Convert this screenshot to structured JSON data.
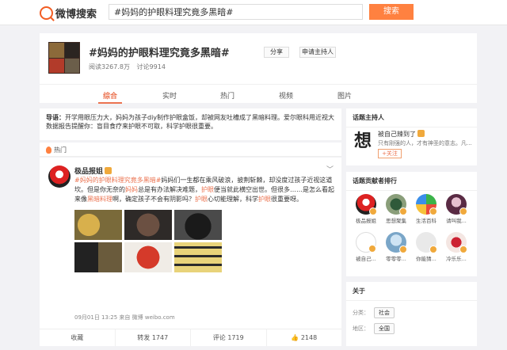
{
  "header": {
    "logo_text": "微博搜索",
    "search_value": "#妈妈的护眼料理究竟多黑暗#",
    "search_button": "搜索"
  },
  "topic": {
    "title": "#妈妈的护眼料理究竟多黑暗#",
    "share_label": "分享",
    "host_apply_label": "申请主持人",
    "reads": "阅读3267.8万",
    "discussions": "讨论9914",
    "tabs": [
      {
        "label": "综合",
        "active": true
      },
      {
        "label": "实时",
        "active": false
      },
      {
        "label": "热门",
        "active": false
      },
      {
        "label": "视频",
        "active": false
      },
      {
        "label": "图片",
        "active": false
      }
    ]
  },
  "lead": {
    "label": "导语：",
    "text": "开学用眼压力大，妈妈为孩子diy制作护眼盒饭，却被网友吐槽成了黑暗料理。爱尔眼科用近视大数据报告提醒你：盲目食疗来护眼不可取，科学护眼很重要。"
  },
  "hot_section": {
    "label": "热门"
  },
  "post": {
    "author": "极品报姐",
    "more": "﹀",
    "text_link1": "#妈妈的护眼料理究竟多黑暗#",
    "text_part1": "妈妈们一生都在乘风破浪，披荆斩棘，却没度过孩子近视这道坎。但是你无奈的",
    "text_link2": "妈妈",
    "text_part2": "总是有办法解决难题，",
    "text_link3": "护眼",
    "text_part3": "便当就此横空出世。但很多……是怎么看起来像",
    "text_link4": "黑暗料理",
    "text_part4": "啊，确定孩子不会有阴影吗？",
    "text_link5": "护眼",
    "text_part5": "心切能理解，科学",
    "text_link6": "护眼",
    "text_part6": "很重要呀。",
    "time": "09月01日 13:25  来自 微博 weibo.com",
    "actions": {
      "collect": "收藏",
      "repost": "转发 1747",
      "comment": "评论 1719",
      "like": "2148"
    }
  },
  "host_panel": {
    "title": "话题主持人",
    "avatar_glyph": "想",
    "name": "被自己辣到了",
    "desc": "只有刚强的人，才有神圣的意志。凡...",
    "follow": "+关注"
  },
  "contrib_panel": {
    "title": "话题贡献者排行",
    "users": [
      {
        "name": "极品报姐"
      },
      {
        "name": "思想聚集"
      },
      {
        "name": "生活百科"
      },
      {
        "name": "请叫我..."
      },
      {
        "name": "被自己..."
      },
      {
        "name": "零零零..."
      },
      {
        "name": "你能猜..."
      },
      {
        "name": "冷乐乐..."
      }
    ]
  },
  "about_panel": {
    "title": "关于",
    "category_label": "分类：",
    "category_value": "社会",
    "region_label": "地区：",
    "region_value": "全国"
  }
}
